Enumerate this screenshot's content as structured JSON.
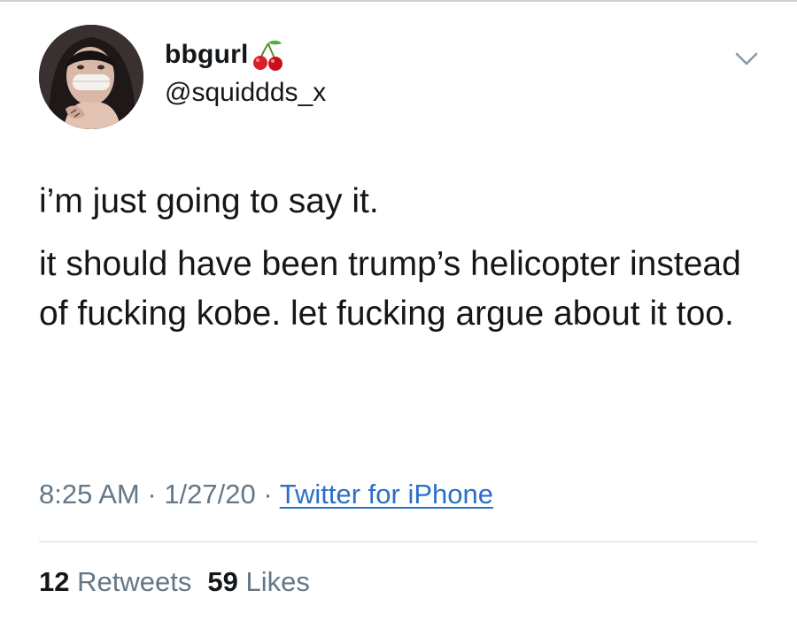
{
  "author": {
    "display_name": "bbgurl",
    "name_emoji": "cherries-icon",
    "handle": "@squiddds_x",
    "avatar": "profile-photo"
  },
  "tweet": {
    "paragraphs": [
      "i’m just going to say it.",
      "it should have been trump’s helicopter instead of fucking kobe. let fucking argue about it too."
    ],
    "time": "8:25 AM",
    "date": "1/27/20",
    "separator": " · ",
    "source": "Twitter for iPhone"
  },
  "stats": {
    "retweets_count": "12",
    "retweets_label": "Retweets",
    "likes_count": "59",
    "likes_label": "Likes"
  },
  "colors": {
    "text": "#14171a",
    "secondary": "#657786",
    "link": "#2b6fc6",
    "divider": "#d6dbe0"
  },
  "icons": {
    "menu": "chevron-down-icon"
  }
}
